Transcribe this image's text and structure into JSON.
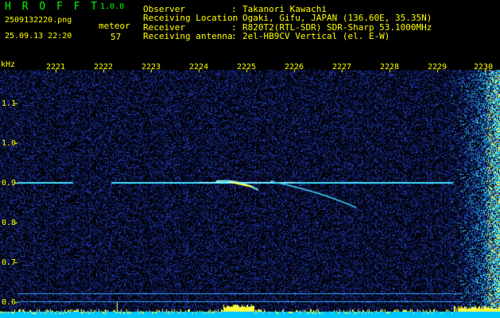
{
  "header": {
    "app_title": "H R O F F T",
    "app_version": "1.0.0",
    "file_name": "2509132220.png",
    "meteor_label": "meteor",
    "datetime": "25.09.13 22:20",
    "meteor_count": "57",
    "info": [
      {
        "key": "Observer",
        "value": "Takanori Kawachi"
      },
      {
        "key": "Receiving Location",
        "value": "Ogaki, Gifu, JAPAN (136.60E, 35.35N)"
      },
      {
        "key": "Receiver",
        "value": "R820T2(RTL-SDR) SDR-Sharp 53.1000MHz"
      },
      {
        "key": "Receiving antenna",
        "value": "2el-HB9CV Vertical (el. E-W)"
      }
    ],
    "separator": ":"
  },
  "spectrogram": {
    "y_unit": "kHz",
    "x_ticks": [
      "2221",
      "2222",
      "2223",
      "2224",
      "2225",
      "2226",
      "2227",
      "2228",
      "2229",
      "2230"
    ],
    "y_ticks": [
      "1.1",
      "1.0",
      "0.9",
      "0.8",
      "0.7",
      "0.6"
    ],
    "colors": {
      "background": "#000000",
      "noise": "#1a2a9a",
      "signal": "#40ffff",
      "meteor": "#ffff40",
      "axis_text": "#ffff00"
    }
  }
}
